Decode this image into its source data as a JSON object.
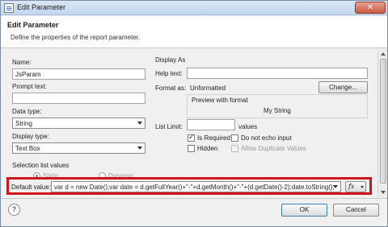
{
  "window": {
    "title": "Edit Parameter",
    "close_glyph": "✕"
  },
  "header": {
    "title": "Edit Parameter",
    "subtitle": "Define the properties of the report parameter."
  },
  "left": {
    "name_label": "Name:",
    "name_value": "JsParam",
    "prompt_label": "Prompt text:",
    "prompt_value": "",
    "data_type_label": "Data type:",
    "data_type_value": "String",
    "display_type_label": "Display type:",
    "display_type_value": "Text Box"
  },
  "right": {
    "display_as_label": "Display As",
    "help_text_label": "Help text:",
    "help_text_value": "",
    "format_as_label": "Format as:",
    "format_as_value": "Unformatted",
    "change_button": "Change...",
    "preview_label": "Preview with format",
    "preview_value": "My String",
    "list_limit_label": "List Limit:",
    "list_limit_value": "",
    "list_limit_unit": "values",
    "is_required_label": "Is Required",
    "is_required_checked": true,
    "do_not_echo_label": "Do not echo input",
    "hidden_label": "Hidden",
    "allow_duplicate_label": "Allow Duplicate Values"
  },
  "selection": {
    "section_label": "Selection list values",
    "static_label": "Static",
    "dynamic_label": "Dynamic"
  },
  "default_value": {
    "label": "Default value:",
    "value": "var d = new Date();var date = d.getFullYear()+\"-\"+d.getMonth()+\"-\"+(d.getDate()-2);date.toString();",
    "fx_label": "fx"
  },
  "footer": {
    "help_glyph": "?",
    "ok_label": "OK",
    "cancel_label": "Cancel"
  },
  "colors": {
    "highlight": "#d0141e",
    "accent": "#3c6fb5"
  }
}
